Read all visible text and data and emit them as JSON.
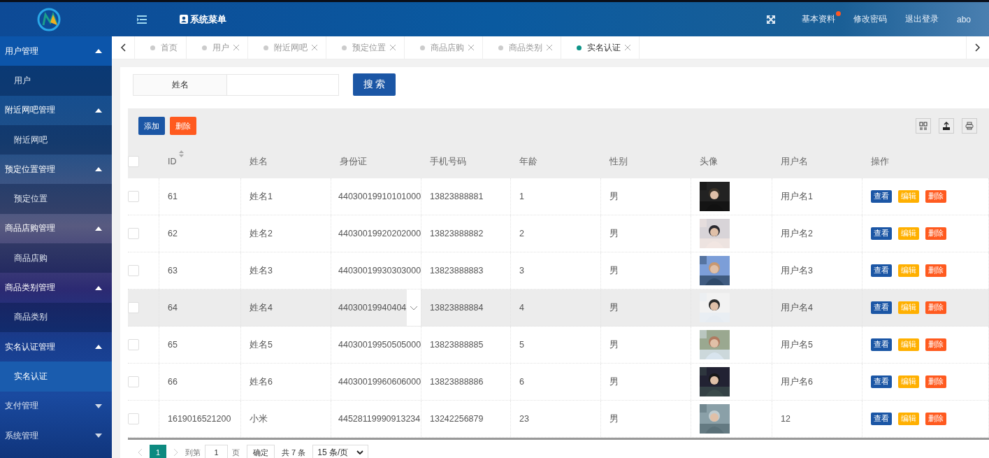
{
  "header": {
    "menu_title": "系统菜单",
    "links": [
      {
        "label": "基本资料",
        "badge": true
      },
      {
        "label": "修改密码",
        "badge": false
      },
      {
        "label": "退出登录",
        "badge": false
      }
    ],
    "user": "abo"
  },
  "sidebar": {
    "groups": [
      {
        "label": "用户管理",
        "expanded": true,
        "children": [
          {
            "label": "用户",
            "selected": false
          }
        ]
      },
      {
        "label": "附近网吧管理",
        "expanded": true,
        "children": [
          {
            "label": "附近网吧",
            "selected": false
          }
        ]
      },
      {
        "label": "预定位置管理",
        "expanded": true,
        "children": [
          {
            "label": "预定位置",
            "selected": false
          }
        ]
      },
      {
        "label": "商品店购管理",
        "expanded": true,
        "children": [
          {
            "label": "商品店购",
            "selected": false
          }
        ]
      },
      {
        "label": "商品类别管理",
        "expanded": true,
        "children": [
          {
            "label": "商品类别",
            "selected": false
          }
        ]
      },
      {
        "label": "实名认证管理",
        "expanded": true,
        "children": [
          {
            "label": "实名认证",
            "selected": true
          }
        ]
      },
      {
        "label": "支付管理",
        "expanded": false
      },
      {
        "label": "系统管理",
        "expanded": false
      }
    ]
  },
  "tabs": [
    {
      "label": "首页",
      "closable": false,
      "selected": false
    },
    {
      "label": "用户",
      "closable": true,
      "selected": false
    },
    {
      "label": "附近网吧",
      "closable": true,
      "selected": false
    },
    {
      "label": "预定位置",
      "closable": true,
      "selected": false
    },
    {
      "label": "商品店购",
      "closable": true,
      "selected": false
    },
    {
      "label": "商品类别",
      "closable": true,
      "selected": false
    },
    {
      "label": "实名认证",
      "closable": true,
      "selected": true
    }
  ],
  "search": {
    "label": "姓名",
    "button": "搜 索"
  },
  "toolbar": {
    "buttons": [
      {
        "label": "添加",
        "kind": "primary"
      },
      {
        "label": "删除",
        "kind": "danger"
      }
    ]
  },
  "table": {
    "columns": [
      "ID",
      "姓名",
      "身份证",
      "手机号码",
      "年龄",
      "性别",
      "头像",
      "用户名",
      "操作"
    ],
    "select_all_checked": false,
    "rows": [
      {
        "checked": false,
        "highlighted": false,
        "expandable": false,
        "id": "61",
        "name": "姓名1",
        "id_card": "44030019910101000",
        "phone": "13823888881",
        "age": "1",
        "gender": "男",
        "username": "用户名1",
        "actions": [
          {
            "label": "查看",
            "kind": "primary"
          },
          {
            "label": "编辑",
            "kind": "warning"
          },
          {
            "label": "删除",
            "kind": "danger"
          }
        ]
      },
      {
        "checked": false,
        "highlighted": false,
        "expandable": false,
        "id": "62",
        "name": "姓名2",
        "id_card": "44030019920202000",
        "phone": "13823888882",
        "age": "2",
        "gender": "男",
        "username": "用户名2",
        "actions": [
          {
            "label": "查看",
            "kind": "primary"
          },
          {
            "label": "编辑",
            "kind": "warning"
          },
          {
            "label": "删除",
            "kind": "danger"
          }
        ]
      },
      {
        "checked": false,
        "highlighted": false,
        "expandable": false,
        "id": "63",
        "name": "姓名3",
        "id_card": "44030019930303000",
        "phone": "13823888883",
        "age": "3",
        "gender": "男",
        "username": "用户名3",
        "actions": [
          {
            "label": "查看",
            "kind": "primary"
          },
          {
            "label": "编辑",
            "kind": "warning"
          },
          {
            "label": "删除",
            "kind": "danger"
          }
        ]
      },
      {
        "checked": false,
        "highlighted": true,
        "expandable": true,
        "id": "64",
        "name": "姓名4",
        "id_card": "44030019940404",
        "phone": "13823888884",
        "age": "4",
        "gender": "男",
        "username": "用户名4",
        "actions": [
          {
            "label": "查看",
            "kind": "primary"
          },
          {
            "label": "编辑",
            "kind": "warning"
          },
          {
            "label": "删除",
            "kind": "danger"
          }
        ]
      },
      {
        "checked": false,
        "highlighted": false,
        "expandable": false,
        "id": "65",
        "name": "姓名5",
        "id_card": "44030019950505000",
        "phone": "13823888885",
        "age": "5",
        "gender": "男",
        "username": "用户名5",
        "actions": [
          {
            "label": "查看",
            "kind": "primary"
          },
          {
            "label": "编辑",
            "kind": "warning"
          },
          {
            "label": "删除",
            "kind": "danger"
          }
        ]
      },
      {
        "checked": false,
        "highlighted": false,
        "expandable": false,
        "id": "66",
        "name": "姓名6",
        "id_card": "44030019960606000",
        "phone": "13823888886",
        "age": "6",
        "gender": "男",
        "username": "用户名6",
        "actions": [
          {
            "label": "查看",
            "kind": "primary"
          },
          {
            "label": "编辑",
            "kind": "warning"
          },
          {
            "label": "删除",
            "kind": "danger"
          }
        ]
      },
      {
        "checked": false,
        "highlighted": false,
        "expandable": false,
        "id": "1619016521200",
        "name": "小米",
        "id_card": "44528119990913234",
        "phone": "13242256879",
        "age": "23",
        "gender": "男",
        "username": "12",
        "actions": [
          {
            "label": "查看",
            "kind": "primary"
          },
          {
            "label": "编辑",
            "kind": "warning"
          },
          {
            "label": "删除",
            "kind": "danger"
          }
        ]
      }
    ]
  },
  "pagination": {
    "pages": [
      {
        "label": "1",
        "selected": true
      }
    ],
    "goto_label": "到第",
    "goto_value": "1",
    "page_unit": "页",
    "confirm": "确定",
    "total": "共 7 条",
    "page_size": "15 条/页"
  }
}
